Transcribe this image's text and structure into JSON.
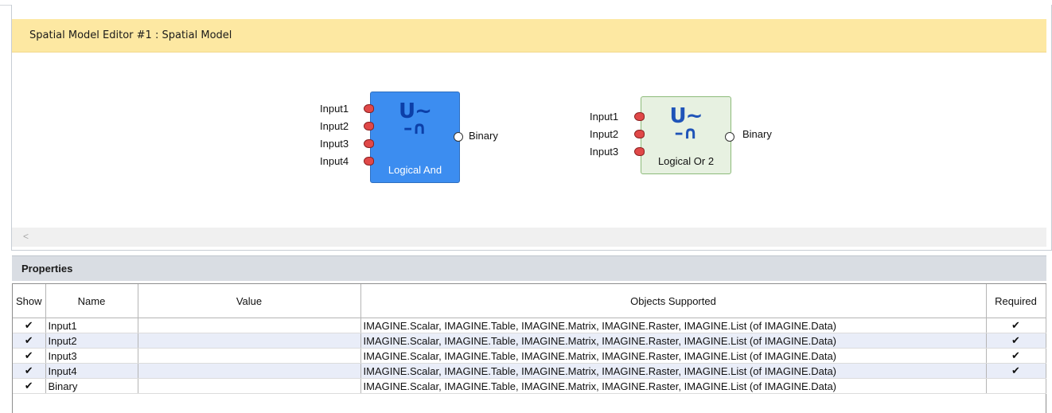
{
  "editor": {
    "title": "Spatial Model Editor #1 : Spatial Model"
  },
  "nodes": {
    "logical_and": {
      "label": "Logical And",
      "inputs": [
        "Input1",
        "Input2",
        "Input3",
        "Input4"
      ],
      "output": "Binary",
      "icon": "logical-operator-icon",
      "color": "#3c8df0",
      "selected": true
    },
    "logical_or": {
      "label": "Logical Or 2",
      "inputs": [
        "Input1",
        "Input2",
        "Input3"
      ],
      "output": "Binary",
      "icon": "logical-operator-icon",
      "color": "#e7f1e1"
    }
  },
  "properties": {
    "title": "Properties",
    "columns": [
      "Show",
      "Name",
      "Value",
      "Objects Supported",
      "Required"
    ],
    "rows": [
      {
        "show": "✔",
        "name": "Input1",
        "value": "",
        "objects": "IMAGINE.Scalar, IMAGINE.Table, IMAGINE.Matrix, IMAGINE.Raster, IMAGINE.List (of IMAGINE.Data)",
        "required": "✔"
      },
      {
        "show": "✔",
        "name": "Input2",
        "value": "",
        "objects": "IMAGINE.Scalar, IMAGINE.Table, IMAGINE.Matrix, IMAGINE.Raster, IMAGINE.List (of IMAGINE.Data)",
        "required": "✔"
      },
      {
        "show": "✔",
        "name": "Input3",
        "value": "",
        "objects": "IMAGINE.Scalar, IMAGINE.Table, IMAGINE.Matrix, IMAGINE.Raster, IMAGINE.List (of IMAGINE.Data)",
        "required": "✔"
      },
      {
        "show": "✔",
        "name": "Input4",
        "value": "",
        "objects": "IMAGINE.Scalar, IMAGINE.Table, IMAGINE.Matrix, IMAGINE.Raster, IMAGINE.List (of IMAGINE.Data)",
        "required": "✔"
      },
      {
        "show": "✔",
        "name": "Binary",
        "value": "",
        "objects": "IMAGINE.Scalar, IMAGINE.Table, IMAGINE.Matrix, IMAGINE.Raster, IMAGINE.List (of IMAGINE.Data)",
        "required": ""
      }
    ]
  },
  "scroll": {
    "left_arrow": "<"
  }
}
